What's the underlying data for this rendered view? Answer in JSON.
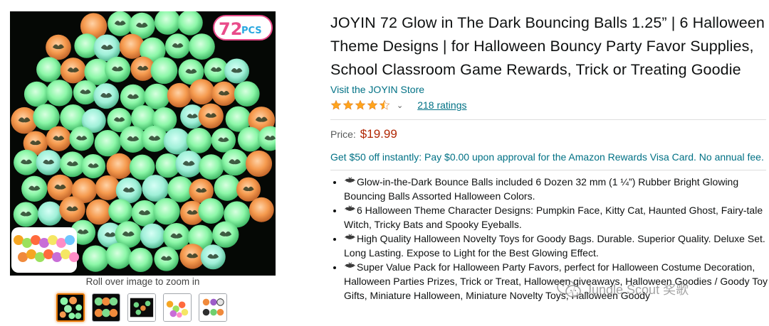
{
  "gallery": {
    "badge_text": "72",
    "badge_suffix": "PCS",
    "zoom_hint": "Roll over image to zoom in",
    "thumbnails": [
      {
        "name": "thumb-glow-balls",
        "active": true
      },
      {
        "name": "thumb-designs",
        "active": false
      },
      {
        "name": "thumb-dark-balls",
        "active": false
      },
      {
        "name": "thumb-colored-balls",
        "active": false
      },
      {
        "name": "thumb-halloween-designs",
        "active": false
      }
    ]
  },
  "product": {
    "title": "JOYIN 72 Glow in The Dark Bouncing Balls 1.25” | 6 Halloween Theme Designs | for Halloween Bouncy Party Favor Supplies, School Classroom Game Rewards, Trick or Treating Goodie",
    "store_link": "Visit the JOYIN Store",
    "rating_stars": 4.5,
    "ratings_count": "218 ratings",
    "price_label": "Price:",
    "price": "$19.99",
    "promo": "Get $50 off instantly: Pay $0.00 upon approval for the Amazon Rewards Visa Card. No annual fee.",
    "bullets": [
      "Glow-in-the-Dark Bounce Balls included 6 Dozen 32 mm (1 ¼”) Rubber Bright Glowing Bouncing Balls Assorted Halloween Colors.",
      "6 Halloween Theme Character Designs: Pumpkin Face, Kitty Cat, Haunted Ghost, Fairy-tale Witch, Tricky Bats and Spooky Eyeballs.",
      "High Quality Halloween Novelty Toys for Goody Bags. Durable. Superior Quality. Deluxe Set. Long Lasting. Expose to Light for the Best Glowing Effect.",
      "Super Value Pack for Halloween Party Favors, perfect for Halloween Costume Decoration, Halloween Parties Prizes, Trick or Treat, Halloween giveaways, Halloween Goodies / Goody Toy Gifts, Miniature Halloween, Miniature Novelty Toys, Halloween Goody"
    ],
    "bullet_icon": "bat-icon"
  },
  "watermark": {
    "text": "Jungle Scout 奖歌",
    "icon": "wechat-icon"
  },
  "colors": {
    "link": "#007185",
    "price": "#b12704",
    "star": "#ffa41c",
    "glow_green": "#8cf7a8",
    "glow_orange": "#f59a4e"
  }
}
